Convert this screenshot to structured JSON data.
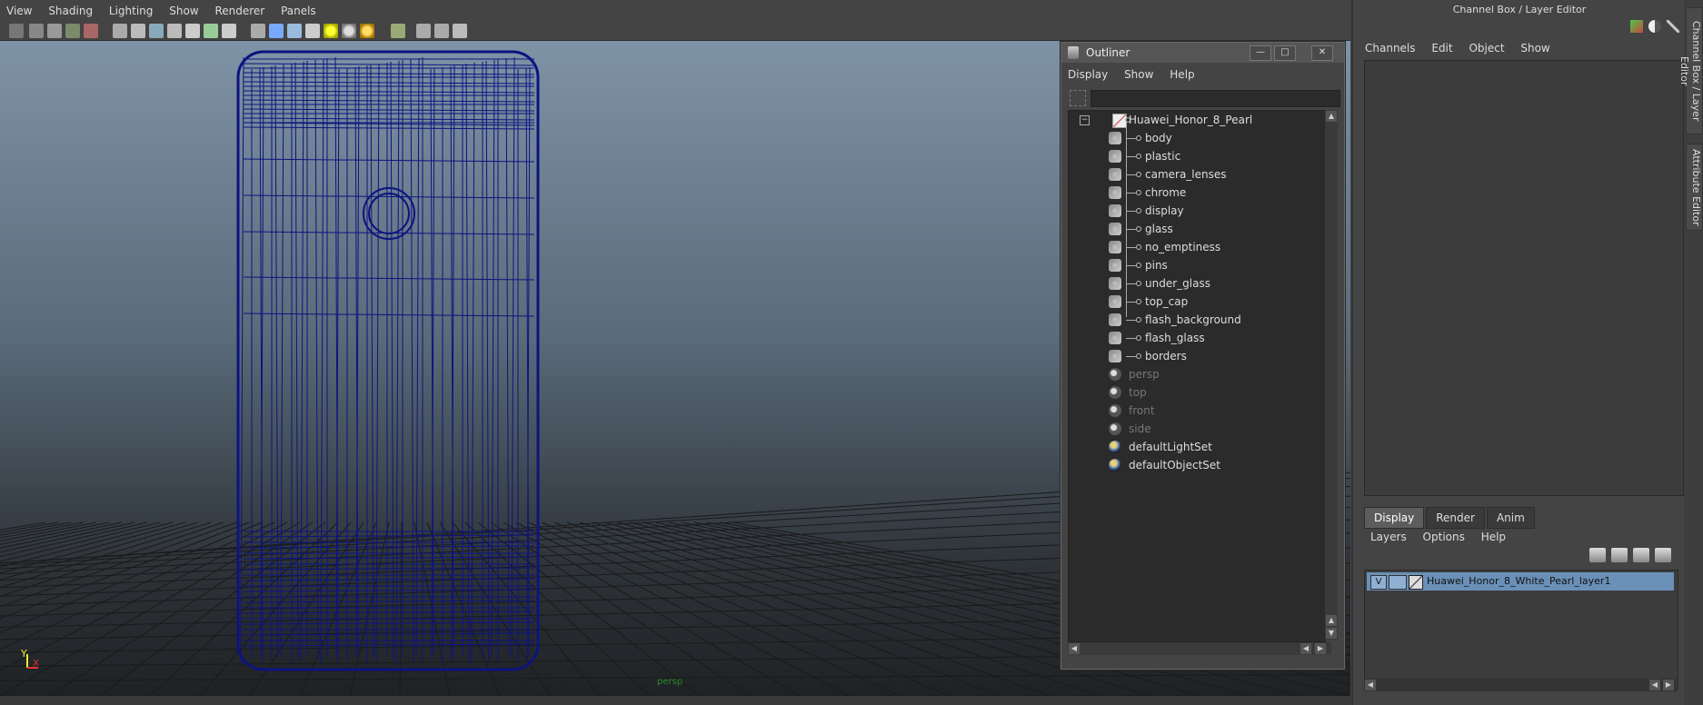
{
  "menu": [
    "View",
    "Shading",
    "Lighting",
    "Show",
    "Renderer",
    "Panels"
  ],
  "viewport": {
    "hud_label": "persp",
    "axis_y": "Y",
    "axis_x": "X",
    "colors": {
      "wireframe": "#0c1480",
      "grid": "#1a1a1a"
    }
  },
  "outliner": {
    "title": "Outliner",
    "menu": [
      "Display",
      "Show",
      "Help"
    ],
    "buttons": {
      "minimize": "—",
      "maximize": "□",
      "close": "✕"
    },
    "root": {
      "label": "Huawei_Honor_8_Pearl",
      "collapse": "−"
    },
    "children": [
      "body",
      "plastic",
      "camera_lenses",
      "chrome",
      "display",
      "glass",
      "no_emptiness",
      "pins",
      "under_glass",
      "top_cap",
      "flash_background",
      "flash_glass",
      "borders"
    ],
    "cameras": [
      "persp",
      "top",
      "front",
      "side"
    ],
    "sets": [
      "defaultLightSet",
      "defaultObjectSet"
    ]
  },
  "right_panel": {
    "title": "Channel Box / Layer Editor",
    "channel_menu": [
      "Channels",
      "Edit",
      "Object",
      "Show"
    ],
    "tabs": [
      "Display",
      "Render",
      "Anim"
    ],
    "active_tab": "Display",
    "layer_menu": [
      "Layers",
      "Options",
      "Help"
    ],
    "layer": {
      "visible_flag": "V",
      "name": "Huawei_Honor_8_White_Pearl_layer1"
    },
    "side_tabs": [
      "Channel Box / Layer Editor",
      "Attribute Editor"
    ]
  }
}
